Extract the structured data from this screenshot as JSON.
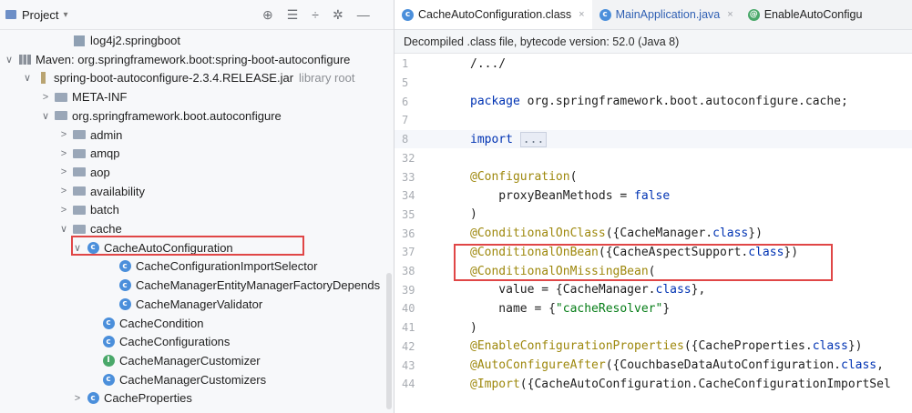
{
  "project_panel": {
    "title": "Project",
    "tools": [
      "⊕",
      "☰",
      "÷",
      "✲",
      "—"
    ],
    "tree": [
      {
        "label": "log4j2.springboot",
        "indent": 80,
        "arrow": "",
        "icon": "log-file-icon"
      },
      {
        "label": "Maven: org.springframework.boot:spring-boot-autoconfigure",
        "indent": 20,
        "arrow": "∨",
        "icon": "maven-library-icon"
      },
      {
        "label": "spring-boot-autoconfigure-2.3.4.RELEASE.jar",
        "suffix": "library root",
        "indent": 40,
        "arrow": "∨",
        "icon": "jar-icon"
      },
      {
        "label": "META-INF",
        "indent": 60,
        "arrow": ">",
        "icon": "folder-icon"
      },
      {
        "label": "org.springframework.boot.autoconfigure",
        "indent": 60,
        "arrow": "∨",
        "icon": "folder-icon"
      },
      {
        "label": "admin",
        "indent": 80,
        "arrow": ">",
        "icon": "folder-icon"
      },
      {
        "label": "amqp",
        "indent": 80,
        "arrow": ">",
        "icon": "folder-icon"
      },
      {
        "label": "aop",
        "indent": 80,
        "arrow": ">",
        "icon": "folder-icon"
      },
      {
        "label": "availability",
        "indent": 80,
        "arrow": ">",
        "icon": "folder-icon"
      },
      {
        "label": "batch",
        "indent": 80,
        "arrow": ">",
        "icon": "folder-icon"
      },
      {
        "label": "cache",
        "indent": 80,
        "arrow": "∨",
        "icon": "folder-icon"
      },
      {
        "label": "CacheAutoConfiguration",
        "indent": 95,
        "arrow": "∨",
        "icon": "class-icon"
      },
      {
        "label": "CacheConfigurationImportSelector",
        "indent": 130,
        "arrow": "",
        "icon": "class-icon"
      },
      {
        "label": "CacheManagerEntityManagerFactoryDepends",
        "indent": 130,
        "arrow": "",
        "icon": "class-icon"
      },
      {
        "label": "CacheManagerValidator",
        "indent": 130,
        "arrow": "",
        "icon": "class-icon"
      },
      {
        "label": "CacheCondition",
        "indent": 112,
        "arrow": "",
        "icon": "class-icon"
      },
      {
        "label": "CacheConfigurations",
        "indent": 112,
        "arrow": "",
        "icon": "class-icon"
      },
      {
        "label": "CacheManagerCustomizer",
        "indent": 112,
        "arrow": "",
        "icon": "interface-icon"
      },
      {
        "label": "CacheManagerCustomizers",
        "indent": 112,
        "arrow": "",
        "icon": "class-icon"
      },
      {
        "label": "CacheProperties",
        "indent": 95,
        "arrow": ">",
        "icon": "class-icon"
      }
    ]
  },
  "editor": {
    "tabs": [
      {
        "label": "CacheAutoConfiguration.class",
        "active": true,
        "closable": true
      },
      {
        "label": "MainApplication.java",
        "active": false,
        "closable": true
      },
      {
        "label": "EnableAutoConfigu",
        "active": false,
        "closable": false
      }
    ],
    "banner": "Decompiled .class file, bytecode version: 52.0 (Java 8)",
    "lines": [
      {
        "n": "1",
        "segs": [
          [
            "",
            "/.../"
          ]
        ]
      },
      {
        "n": "5",
        "segs": []
      },
      {
        "n": "6",
        "segs": [
          [
            "kw",
            "package"
          ],
          [
            "",
            " org.springframework.boot.autoconfigure.cache;"
          ]
        ]
      },
      {
        "n": "7",
        "segs": []
      },
      {
        "n": "8",
        "segs": [
          [
            "kw",
            "import"
          ],
          [
            "",
            " "
          ],
          [
            "fold",
            "..."
          ]
        ]
      },
      {
        "n": "32",
        "segs": []
      },
      {
        "n": "33",
        "segs": [
          [
            "ann",
            "@Configuration"
          ],
          [
            "",
            "("
          ]
        ]
      },
      {
        "n": "34",
        "segs": [
          [
            "",
            "    proxyBeanMethods = "
          ],
          [
            "kw",
            "false"
          ]
        ]
      },
      {
        "n": "35",
        "segs": [
          [
            "",
            ")"
          ]
        ]
      },
      {
        "n": "36",
        "segs": [
          [
            "ann",
            "@ConditionalOnClass"
          ],
          [
            "",
            "({CacheManager."
          ],
          [
            "kw",
            "class"
          ],
          [
            "",
            "})"
          ]
        ]
      },
      {
        "n": "37",
        "segs": [
          [
            "ann",
            "@ConditionalOnBean"
          ],
          [
            "",
            "({CacheAspectSupport."
          ],
          [
            "kw",
            "class"
          ],
          [
            "",
            "})"
          ]
        ]
      },
      {
        "n": "38",
        "segs": [
          [
            "ann",
            "@ConditionalOnMissingBean"
          ],
          [
            "",
            "("
          ]
        ]
      },
      {
        "n": "39",
        "segs": [
          [
            "",
            "    value = {CacheManager."
          ],
          [
            "kw",
            "class"
          ],
          [
            "",
            "},"
          ]
        ]
      },
      {
        "n": "40",
        "segs": [
          [
            "",
            "    name = {"
          ],
          [
            "str",
            "\"cacheResolver\""
          ],
          [
            "",
            "}"
          ]
        ]
      },
      {
        "n": "41",
        "segs": [
          [
            "",
            ")"
          ]
        ]
      },
      {
        "n": "42",
        "segs": [
          [
            "ann",
            "@EnableConfigurationProperties"
          ],
          [
            "",
            "({CacheProperties."
          ],
          [
            "kw",
            "class"
          ],
          [
            "",
            "})"
          ]
        ]
      },
      {
        "n": "43",
        "segs": [
          [
            "ann",
            "@AutoConfigureAfter"
          ],
          [
            "",
            "({CouchbaseDataAutoConfiguration."
          ],
          [
            "kw",
            "class"
          ],
          [
            "",
            ","
          ]
        ]
      },
      {
        "n": "44",
        "segs": [
          [
            "ann",
            "@Import"
          ],
          [
            "",
            "({CacheAutoConfiguration.CacheConfigurationImportSel"
          ]
        ]
      }
    ]
  },
  "colors": {
    "accent": "#e04646",
    "keyword": "#0033b3",
    "annotation": "#9e880d",
    "string": "#067d17"
  }
}
